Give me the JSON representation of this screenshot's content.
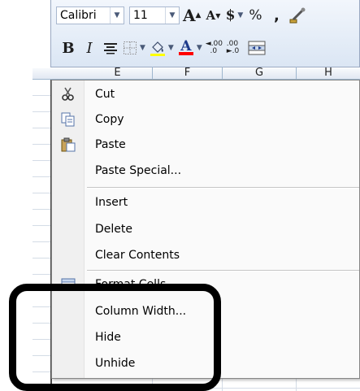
{
  "mini_toolbar": {
    "font_name": "Calibri",
    "font_size": "11",
    "currency_symbol": "$",
    "percent_symbol": "%",
    "comma_symbol": ",",
    "bold_label": "B",
    "italic_label": "I",
    "font_color_label": "A",
    "increase_decimal_label": ".00",
    "decrease_decimal_label": ".00"
  },
  "column_headers": [
    "E",
    "F",
    "G",
    "H"
  ],
  "context_menu": {
    "items": [
      {
        "label": "Cut",
        "icon": "scissors-icon"
      },
      {
        "label": "Copy",
        "icon": "copy-icon"
      },
      {
        "label": "Paste",
        "icon": "paste-icon"
      },
      {
        "label": "Paste Special..."
      },
      {
        "label": "Insert"
      },
      {
        "label": "Delete"
      },
      {
        "label": "Clear Contents"
      },
      {
        "label": "Format Cells...",
        "icon": "format-cells-icon"
      },
      {
        "label": "Column Width..."
      },
      {
        "label": "Hide"
      },
      {
        "label": "Unhide"
      }
    ]
  },
  "colors": {
    "highlight_box": "#000000",
    "font_color_bar": "#ff0000",
    "fill_color_bar": "#ffff00"
  }
}
